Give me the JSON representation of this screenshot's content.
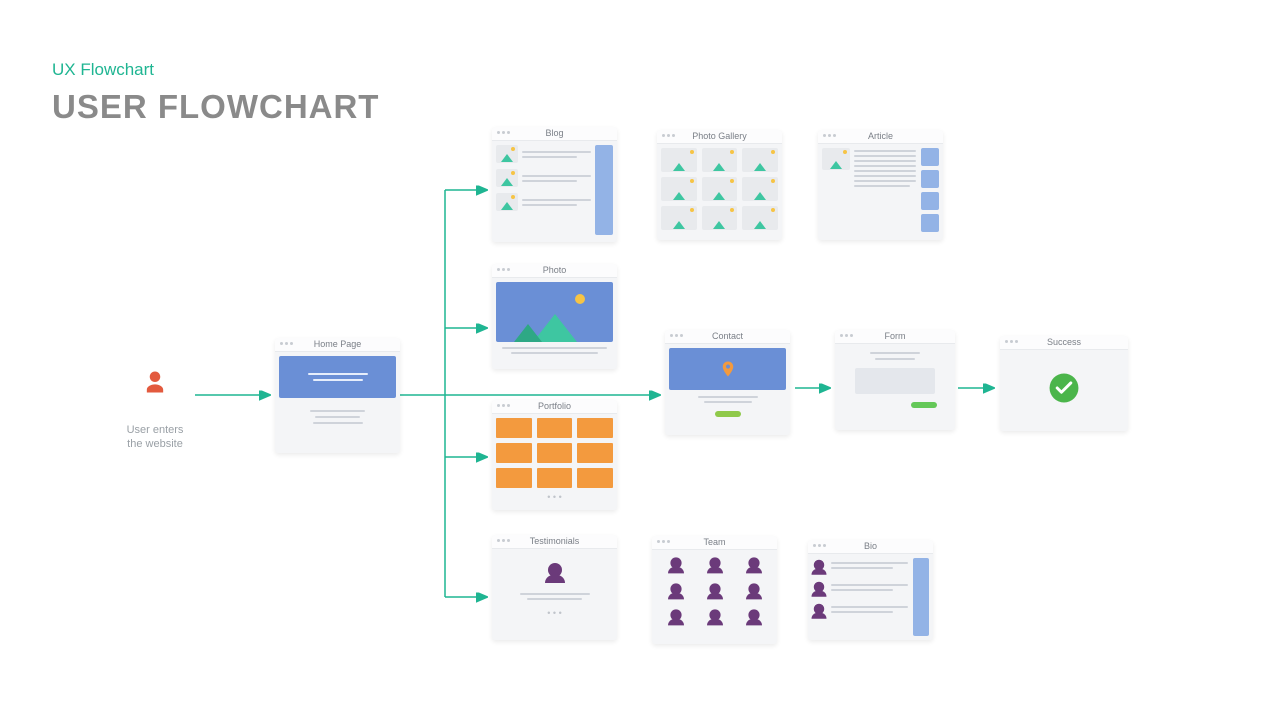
{
  "subtitle": "UX Flowchart",
  "title": "USER FLOWCHART",
  "user": {
    "caption_l1": "User enters",
    "caption_l2": "the website"
  },
  "cards": {
    "home": "Home Page",
    "blog": "Blog",
    "gallery": "Photo Gallery",
    "article": "Article",
    "photo": "Photo",
    "portfolio": "Portfolio",
    "testimonials": "Testimonials",
    "contact": "Contact",
    "form": "Form",
    "success": "Success",
    "team": "Team",
    "bio": "Bio"
  },
  "colors": {
    "accent": "#1fb592",
    "blue": "#6a8fd6",
    "orange": "#f39a3e",
    "green": "#4caf50",
    "userRed": "#e35a3e"
  }
}
